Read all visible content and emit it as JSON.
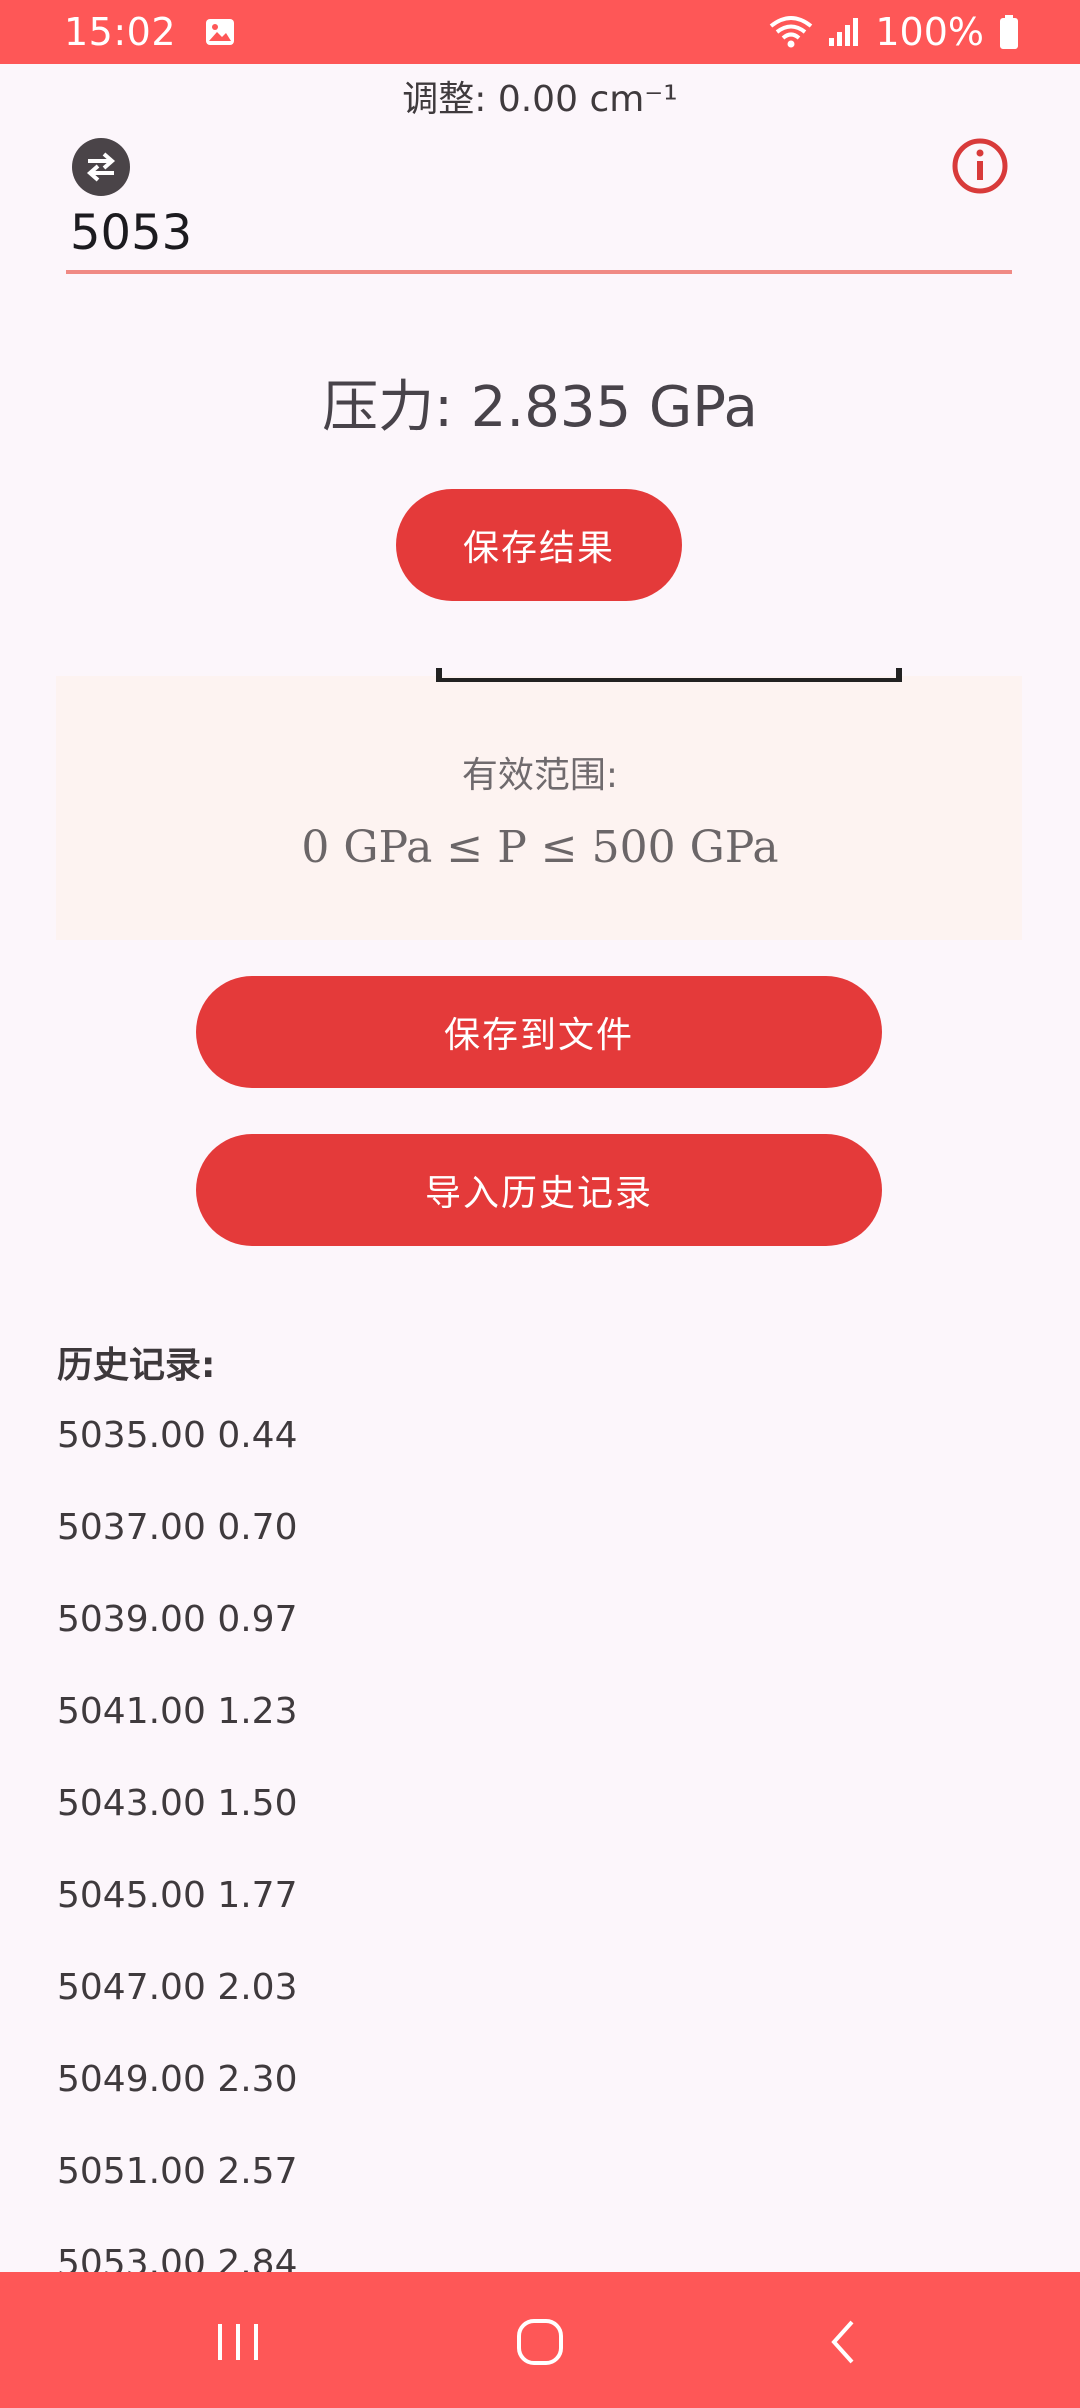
{
  "status_bar": {
    "time": "15:02",
    "battery": "100%",
    "icons": [
      "gallery-icon",
      "wifi-icon",
      "signal-icon",
      "battery-icon"
    ]
  },
  "adjust": {
    "label": "调整: 0.00 cm⁻¹"
  },
  "input": {
    "value": "5053"
  },
  "pressure": {
    "text": "压力: 2.835 GPa"
  },
  "buttons": {
    "save_result": "保存结果",
    "save_to_file": "保存到文件",
    "import_history": "导入历史记录"
  },
  "range": {
    "title": "有效范围:",
    "formula": "0 GPa ≤ P ≤ 500 GPa"
  },
  "history": {
    "title": "历史记录:",
    "items": [
      "5035.00 0.44",
      "5037.00 0.70",
      "5039.00 0.97",
      "5041.00 1.23",
      "5043.00 1.50",
      "5045.00 1.77",
      "5047.00 2.03",
      "5049.00 2.30",
      "5051.00 2.57",
      "5053.00 2.84"
    ]
  },
  "colors": {
    "accent": "#e43a3a",
    "bar": "#fe5757",
    "background": "#fcf6fb",
    "card": "#fdf3f1"
  }
}
